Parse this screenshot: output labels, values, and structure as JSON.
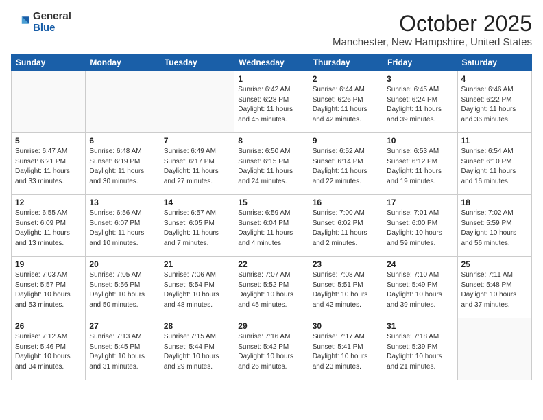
{
  "header": {
    "logo_general": "General",
    "logo_blue": "Blue",
    "month_title": "October 2025",
    "location": "Manchester, New Hampshire, United States"
  },
  "days_of_week": [
    "Sunday",
    "Monday",
    "Tuesday",
    "Wednesday",
    "Thursday",
    "Friday",
    "Saturday"
  ],
  "weeks": [
    [
      {
        "day": "",
        "content": ""
      },
      {
        "day": "",
        "content": ""
      },
      {
        "day": "",
        "content": ""
      },
      {
        "day": "1",
        "content": "Sunrise: 6:42 AM\nSunset: 6:28 PM\nDaylight: 11 hours and 45 minutes."
      },
      {
        "day": "2",
        "content": "Sunrise: 6:44 AM\nSunset: 6:26 PM\nDaylight: 11 hours and 42 minutes."
      },
      {
        "day": "3",
        "content": "Sunrise: 6:45 AM\nSunset: 6:24 PM\nDaylight: 11 hours and 39 minutes."
      },
      {
        "day": "4",
        "content": "Sunrise: 6:46 AM\nSunset: 6:22 PM\nDaylight: 11 hours and 36 minutes."
      }
    ],
    [
      {
        "day": "5",
        "content": "Sunrise: 6:47 AM\nSunset: 6:21 PM\nDaylight: 11 hours and 33 minutes."
      },
      {
        "day": "6",
        "content": "Sunrise: 6:48 AM\nSunset: 6:19 PM\nDaylight: 11 hours and 30 minutes."
      },
      {
        "day": "7",
        "content": "Sunrise: 6:49 AM\nSunset: 6:17 PM\nDaylight: 11 hours and 27 minutes."
      },
      {
        "day": "8",
        "content": "Sunrise: 6:50 AM\nSunset: 6:15 PM\nDaylight: 11 hours and 24 minutes."
      },
      {
        "day": "9",
        "content": "Sunrise: 6:52 AM\nSunset: 6:14 PM\nDaylight: 11 hours and 22 minutes."
      },
      {
        "day": "10",
        "content": "Sunrise: 6:53 AM\nSunset: 6:12 PM\nDaylight: 11 hours and 19 minutes."
      },
      {
        "day": "11",
        "content": "Sunrise: 6:54 AM\nSunset: 6:10 PM\nDaylight: 11 hours and 16 minutes."
      }
    ],
    [
      {
        "day": "12",
        "content": "Sunrise: 6:55 AM\nSunset: 6:09 PM\nDaylight: 11 hours and 13 minutes."
      },
      {
        "day": "13",
        "content": "Sunrise: 6:56 AM\nSunset: 6:07 PM\nDaylight: 11 hours and 10 minutes."
      },
      {
        "day": "14",
        "content": "Sunrise: 6:57 AM\nSunset: 6:05 PM\nDaylight: 11 hours and 7 minutes."
      },
      {
        "day": "15",
        "content": "Sunrise: 6:59 AM\nSunset: 6:04 PM\nDaylight: 11 hours and 4 minutes."
      },
      {
        "day": "16",
        "content": "Sunrise: 7:00 AM\nSunset: 6:02 PM\nDaylight: 11 hours and 2 minutes."
      },
      {
        "day": "17",
        "content": "Sunrise: 7:01 AM\nSunset: 6:00 PM\nDaylight: 10 hours and 59 minutes."
      },
      {
        "day": "18",
        "content": "Sunrise: 7:02 AM\nSunset: 5:59 PM\nDaylight: 10 hours and 56 minutes."
      }
    ],
    [
      {
        "day": "19",
        "content": "Sunrise: 7:03 AM\nSunset: 5:57 PM\nDaylight: 10 hours and 53 minutes."
      },
      {
        "day": "20",
        "content": "Sunrise: 7:05 AM\nSunset: 5:56 PM\nDaylight: 10 hours and 50 minutes."
      },
      {
        "day": "21",
        "content": "Sunrise: 7:06 AM\nSunset: 5:54 PM\nDaylight: 10 hours and 48 minutes."
      },
      {
        "day": "22",
        "content": "Sunrise: 7:07 AM\nSunset: 5:52 PM\nDaylight: 10 hours and 45 minutes."
      },
      {
        "day": "23",
        "content": "Sunrise: 7:08 AM\nSunset: 5:51 PM\nDaylight: 10 hours and 42 minutes."
      },
      {
        "day": "24",
        "content": "Sunrise: 7:10 AM\nSunset: 5:49 PM\nDaylight: 10 hours and 39 minutes."
      },
      {
        "day": "25",
        "content": "Sunrise: 7:11 AM\nSunset: 5:48 PM\nDaylight: 10 hours and 37 minutes."
      }
    ],
    [
      {
        "day": "26",
        "content": "Sunrise: 7:12 AM\nSunset: 5:46 PM\nDaylight: 10 hours and 34 minutes."
      },
      {
        "day": "27",
        "content": "Sunrise: 7:13 AM\nSunset: 5:45 PM\nDaylight: 10 hours and 31 minutes."
      },
      {
        "day": "28",
        "content": "Sunrise: 7:15 AM\nSunset: 5:44 PM\nDaylight: 10 hours and 29 minutes."
      },
      {
        "day": "29",
        "content": "Sunrise: 7:16 AM\nSunset: 5:42 PM\nDaylight: 10 hours and 26 minutes."
      },
      {
        "day": "30",
        "content": "Sunrise: 7:17 AM\nSunset: 5:41 PM\nDaylight: 10 hours and 23 minutes."
      },
      {
        "day": "31",
        "content": "Sunrise: 7:18 AM\nSunset: 5:39 PM\nDaylight: 10 hours and 21 minutes."
      },
      {
        "day": "",
        "content": ""
      }
    ]
  ]
}
